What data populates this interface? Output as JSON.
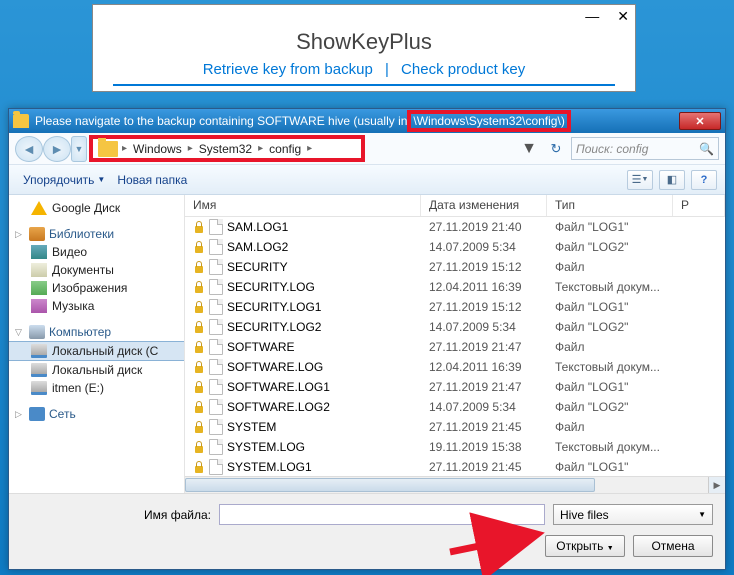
{
  "skp": {
    "title": "ShowKeyPlus",
    "link_retrieve": "Retrieve key from backup",
    "link_check": "Check product key",
    "min": "—",
    "close": "✕"
  },
  "dialog": {
    "title_prefix": "Please navigate to the backup containing SOFTWARE hive (usually in",
    "title_path": "\\Windows\\System32\\config\\)",
    "close": "✕"
  },
  "breadcrumb": {
    "segments": [
      "Windows",
      "System32",
      "config"
    ]
  },
  "search": {
    "placeholder": "Поиск: config"
  },
  "toolbar": {
    "organize": "Упорядочить",
    "newfolder": "Новая папка"
  },
  "sidebar": {
    "gdrive": "Google Диск",
    "libraries": "Библиотеки",
    "videos": "Видео",
    "documents": "Документы",
    "pictures": "Изображения",
    "music": "Музыка",
    "computer": "Компьютер",
    "localdisk": "Локальный диск (C",
    "localdisk2": "Локальный диск",
    "itmen": "itmen (E:)",
    "network": "Сеть"
  },
  "columns": {
    "name": "Имя",
    "date": "Дата изменения",
    "type": "Тип",
    "size": "Р"
  },
  "files": [
    {
      "name": "SAM.LOG1",
      "date": "27.11.2019 21:40",
      "type": "Файл \"LOG1\""
    },
    {
      "name": "SAM.LOG2",
      "date": "14.07.2009 5:34",
      "type": "Файл \"LOG2\""
    },
    {
      "name": "SECURITY",
      "date": "27.11.2019 15:12",
      "type": "Файл"
    },
    {
      "name": "SECURITY.LOG",
      "date": "12.04.2011 16:39",
      "type": "Текстовый докум..."
    },
    {
      "name": "SECURITY.LOG1",
      "date": "27.11.2019 15:12",
      "type": "Файл \"LOG1\""
    },
    {
      "name": "SECURITY.LOG2",
      "date": "14.07.2009 5:34",
      "type": "Файл \"LOG2\""
    },
    {
      "name": "SOFTWARE",
      "date": "27.11.2019 21:47",
      "type": "Файл"
    },
    {
      "name": "SOFTWARE.LOG",
      "date": "12.04.2011 16:39",
      "type": "Текстовый докум..."
    },
    {
      "name": "SOFTWARE.LOG1",
      "date": "27.11.2019 21:47",
      "type": "Файл \"LOG1\""
    },
    {
      "name": "SOFTWARE.LOG2",
      "date": "14.07.2009 5:34",
      "type": "Файл \"LOG2\""
    },
    {
      "name": "SYSTEM",
      "date": "27.11.2019 21:45",
      "type": "Файл"
    },
    {
      "name": "SYSTEM.LOG",
      "date": "19.11.2019 15:38",
      "type": "Текстовый докум..."
    },
    {
      "name": "SYSTEM.LOG1",
      "date": "27.11.2019 21:45",
      "type": "Файл \"LOG1\""
    }
  ],
  "bottom": {
    "filename_label": "Имя файла:",
    "filename_value": "",
    "filter": "Hive files",
    "open": "Открыть",
    "cancel": "Отмена"
  }
}
